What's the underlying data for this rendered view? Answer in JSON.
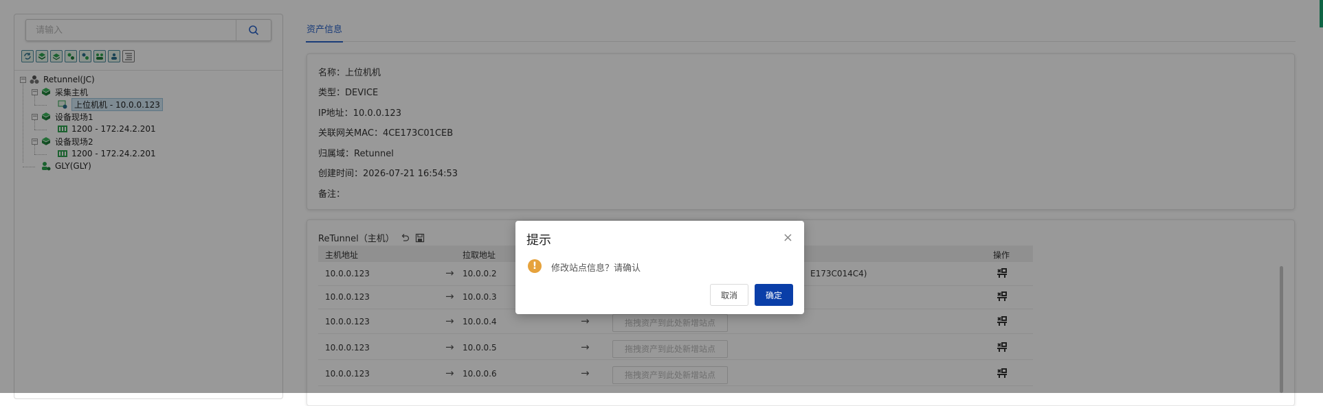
{
  "search": {
    "placeholder": "请输入"
  },
  "toolbar": {
    "buttons": [
      "refresh-icon",
      "expand-icon",
      "collapse-icon",
      "settings-green-icon",
      "settings-blue-icon",
      "group-icon",
      "users-icon",
      "list-icon"
    ]
  },
  "tree": {
    "root": "Retunnel(JC)",
    "n1": "采集主机",
    "n1_1": "上位机机 - 10.0.0.123",
    "n2": "设备现场1",
    "n2_1": "1200 - 172.24.2.201",
    "n3": "设备现场2",
    "n3_1": "1200 - 172.24.2.201",
    "n4": "GLY(GLY)"
  },
  "tabs": {
    "asset_info": "资产信息"
  },
  "info": {
    "name": "名称：上位机机",
    "type": "类型：DEVICE",
    "ip": "IP地址：10.0.0.123",
    "mac": "关联网关MAC：4CE173C01CEB",
    "domain": "归属域：Retunnel",
    "created": "创建时间：2026-07-21 16:54:53",
    "remark": "备注："
  },
  "tunnel": {
    "title": "ReTunnel（主机）",
    "columns": {
      "host": "主机地址",
      "pull": "拉取地址",
      "op": "操作"
    },
    "rows": [
      {
        "host": "10.0.0.123",
        "arrow": "→",
        "pull": "10.0.0.2",
        "site": "E173C014C4)"
      },
      {
        "host": "10.0.0.123",
        "arrow": "→",
        "pull": "10.0.0.3"
      },
      {
        "host": "10.0.0.123",
        "arrow": "→",
        "pull": "10.0.0.4",
        "arrow2": "→",
        "drop": "拖拽资产到此处新增站点"
      },
      {
        "host": "10.0.0.123",
        "arrow": "→",
        "pull": "10.0.0.5",
        "arrow2": "→",
        "drop": "拖拽资产到此处新增站点"
      },
      {
        "host": "10.0.0.123",
        "arrow": "→",
        "pull": "10.0.0.6",
        "arrow2": "→",
        "drop": "拖拽资产到此处新增站点"
      }
    ]
  },
  "dialog": {
    "title": "提示",
    "close": "×",
    "icon": "!",
    "message": "修改站点信息？请确认",
    "cancel": "取消",
    "confirm": "确定"
  },
  "colors": {
    "primary": "#0a3ea8",
    "tab": "#2a63c9",
    "warning": "#e6a23c",
    "tree_green": "#2ea44f"
  }
}
